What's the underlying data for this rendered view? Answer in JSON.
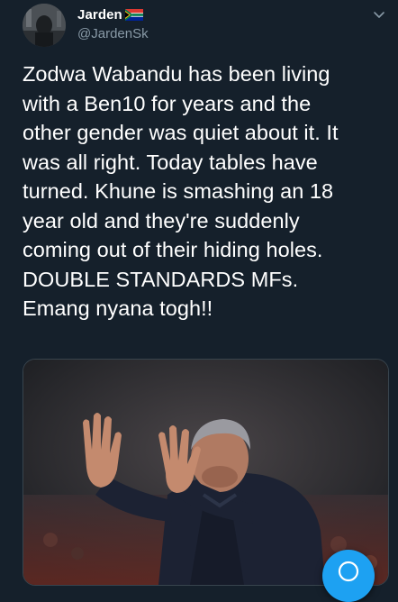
{
  "tweet": {
    "author": {
      "display_name": "Jarden",
      "flag_icon": "south-africa-flag-icon",
      "handle": "@JardenSk",
      "avatar_icon": "user-avatar"
    },
    "more_menu_icon": "chevron-down-icon",
    "text": "Zodwa Wabandu has been living\nwith a Ben10 for years and the\nother gender was quiet about it. It\nwas all right. Today tables have\nturned. Khune is smashing an 18\nyear old and they're suddenly\ncoming out of their hiding holes.\nDOUBLE STANDARDS MFs.\nEmang nyana togh!!",
    "media": {
      "description_icon": "photo-man-raising-hands"
    }
  },
  "compose_button": {
    "icon": "compose-icon"
  },
  "colors": {
    "background": "#15202b",
    "secondary_text": "#8899a6",
    "accent": "#1da1f2"
  }
}
